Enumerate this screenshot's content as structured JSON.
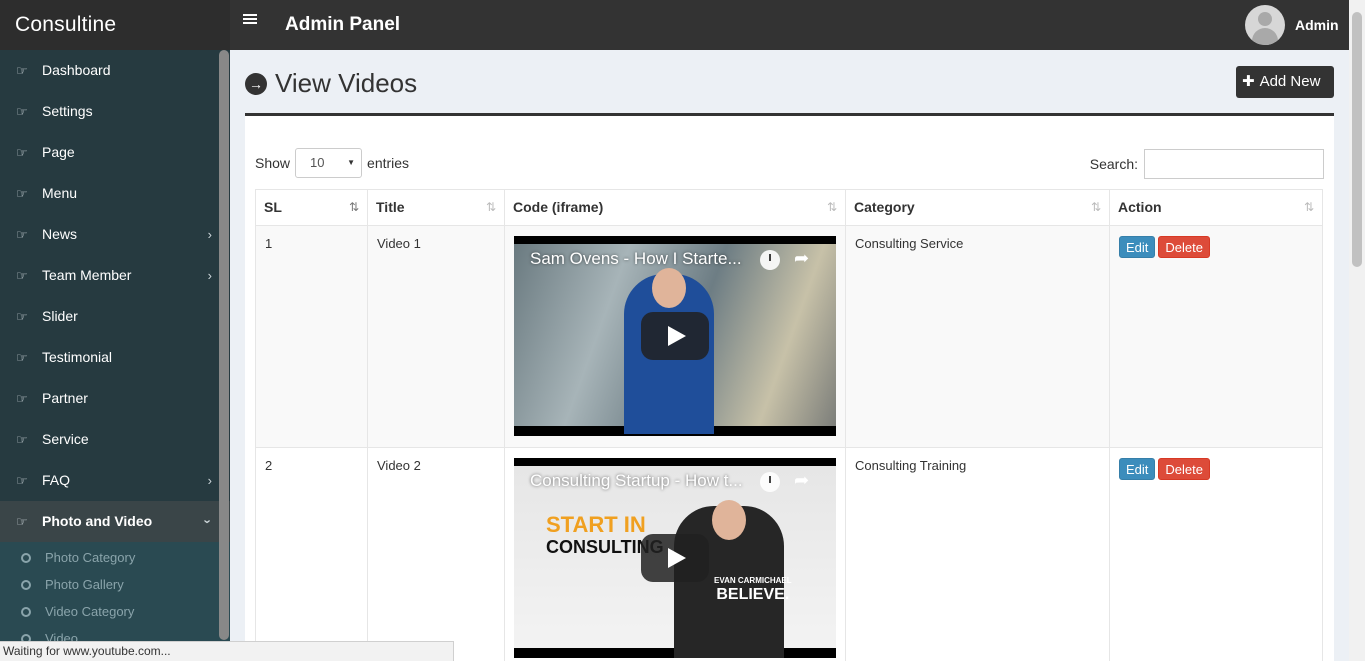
{
  "brand": "Consultine",
  "header": {
    "title": "Admin Panel",
    "user": "Admin"
  },
  "sidebar": {
    "items": [
      {
        "label": "Dashboard"
      },
      {
        "label": "Settings"
      },
      {
        "label": "Page"
      },
      {
        "label": "Menu"
      },
      {
        "label": "News",
        "has_children": true
      },
      {
        "label": "Team Member",
        "has_children": true
      },
      {
        "label": "Slider"
      },
      {
        "label": "Testimonial"
      },
      {
        "label": "Partner"
      },
      {
        "label": "Service"
      },
      {
        "label": "FAQ",
        "has_children": true
      },
      {
        "label": "Photo and Video",
        "has_children": true,
        "active": true
      }
    ],
    "subitems": [
      "Photo Category",
      "Photo Gallery",
      "Video Category",
      "Video"
    ]
  },
  "page": {
    "title": "View Videos",
    "add_label": "Add New"
  },
  "table_controls": {
    "show_label": "Show",
    "entries_value": "10",
    "entries_label": "entries",
    "search_label": "Search:"
  },
  "table": {
    "headers": [
      "SL",
      "Title",
      "Code (iframe)",
      "Category",
      "Action"
    ],
    "rows": [
      {
        "sl": "1",
        "title": "Video 1",
        "video_title": "Sam Ovens - How I Starte...",
        "category": "Consulting Service"
      },
      {
        "sl": "2",
        "title": "Video 2",
        "video_title": "Consulting Startup - How t...",
        "category": "Consulting Training",
        "overlay_line1": "START IN",
        "overlay_line2": "CONSULTING",
        "shirt_line1": "EVAN CARMICHAEL",
        "shirt_line2": "BELIEVE."
      }
    ],
    "edit_label": "Edit",
    "delete_label": "Delete"
  },
  "status": "Waiting for www.youtube.com...",
  "colors": {
    "sidebar": "#263a40",
    "header": "#333333",
    "edit": "#3c8dbc",
    "delete": "#dd4b39"
  }
}
